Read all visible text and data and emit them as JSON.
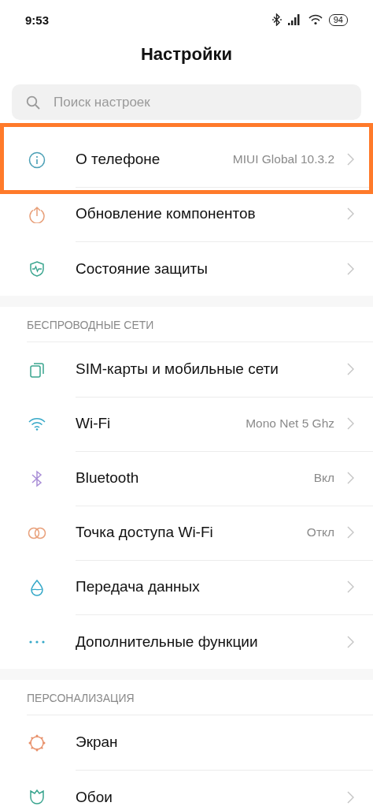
{
  "status_bar": {
    "time": "9:53",
    "battery": "94"
  },
  "title": "Настройки",
  "search": {
    "placeholder": "Поиск настроек"
  },
  "sections": [
    {
      "items": [
        {
          "kind": "info",
          "label": "О телефоне",
          "value": "MIUI Global 10.3.2",
          "chevron": true,
          "highlighted": true
        },
        {
          "kind": "update",
          "label": "Обновление компонентов",
          "chevron": true,
          "highlighted": false
        },
        {
          "kind": "shield",
          "label": "Состояние защиты",
          "chevron": true,
          "highlighted": false
        }
      ]
    },
    {
      "header": "БЕСПРОВОДНЫЕ СЕТИ",
      "items": [
        {
          "kind": "sim",
          "label": "SIM-карты и мобильные сети",
          "chevron": true,
          "highlighted": false
        },
        {
          "kind": "wifi",
          "label": "Wi-Fi",
          "value": "Mono Net 5 Ghz",
          "chevron": true,
          "highlighted": false
        },
        {
          "kind": "bluetooth",
          "label": "Bluetooth",
          "value": "Вкл",
          "chevron": true,
          "highlighted": false
        },
        {
          "kind": "hotspot",
          "label": "Точка доступа Wi-Fi",
          "value": "Откл",
          "chevron": true,
          "highlighted": false
        },
        {
          "kind": "data",
          "label": "Передача данных",
          "chevron": true,
          "highlighted": false
        },
        {
          "kind": "more",
          "label": "Дополнительные функции",
          "chevron": true,
          "highlighted": false
        }
      ]
    },
    {
      "header": "ПЕРСОНАЛИЗАЦИЯ",
      "items": [
        {
          "kind": "display",
          "label": "Экран",
          "chevron": false,
          "highlighted": false
        },
        {
          "kind": "wallpaper",
          "label": "Обои",
          "chevron": true,
          "highlighted": false
        }
      ]
    }
  ]
}
